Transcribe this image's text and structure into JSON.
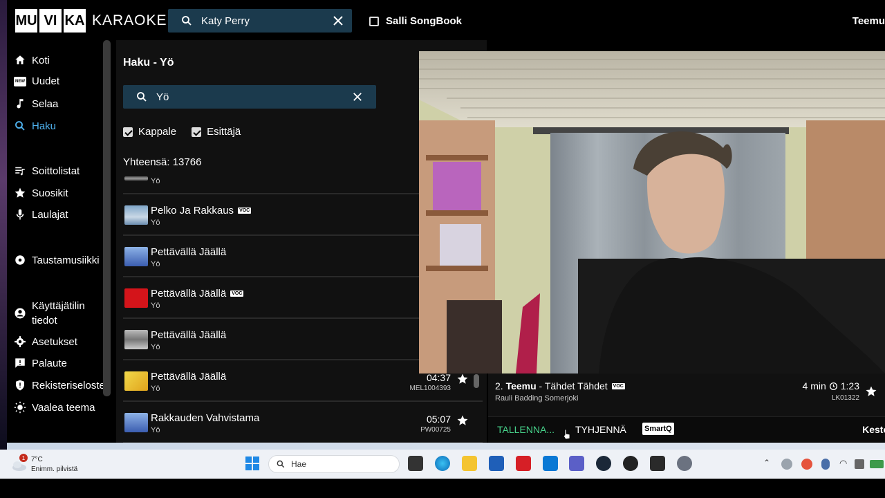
{
  "header": {
    "logo_letters": [
      "MU",
      "VI",
      "KA"
    ],
    "logo_word": "KARAOKE",
    "search_value": "Katy Perry",
    "songbook_label": "Salli SongBook",
    "user_label": "Teemu"
  },
  "sidebar": {
    "items": [
      {
        "label": "Koti"
      },
      {
        "label": "Uudet",
        "badge": "NEW"
      },
      {
        "label": "Selaa"
      },
      {
        "label": "Haku"
      },
      {
        "label": "Soittolistat"
      },
      {
        "label": "Suosikit"
      },
      {
        "label": "Laulajat"
      },
      {
        "label": "Taustamusiikki"
      },
      {
        "label": "Käyttäjätilin tiedot"
      },
      {
        "label": "Asetukset"
      },
      {
        "label": "Palaute"
      },
      {
        "label": "Rekisteriseloste"
      },
      {
        "label": "Vaalea teema"
      }
    ]
  },
  "search_panel": {
    "title": "Haku - Yö",
    "query": "Yö",
    "filter_song": "Kappale",
    "filter_artist": "Esittäjä",
    "total": "Yhteensä: 13766",
    "voc_label": "VOC",
    "results": [
      {
        "title": "",
        "artist": "Yö"
      },
      {
        "title": "Pelko Ja Rakkaus",
        "artist": "Yö",
        "voc": true
      },
      {
        "title": "Pettävällä Jäällä",
        "artist": "Yö"
      },
      {
        "title": "Pettävällä Jäällä",
        "artist": "Yö",
        "voc": true
      },
      {
        "title": "Pettävällä Jäällä",
        "artist": "Yö"
      },
      {
        "title": "Pettävällä Jäällä",
        "artist": "Yö",
        "duration": "04:37",
        "code": "MEL1004393"
      },
      {
        "title": "Rakkauden Vahvistama",
        "artist": "Yö",
        "duration": "05:07",
        "code": "PW00725"
      }
    ]
  },
  "queue": {
    "number": "2.",
    "singer": "Teemu",
    "song": " - Tähdet Tähdet",
    "artist": "Rauli Badding Somerjoki",
    "time_left": "4 min",
    "duration": "1:23",
    "code": "LK01322",
    "save_label": "TALLENNA...",
    "clear_label": "TYHJENNÄ",
    "smartq_label": "SmartQ",
    "duration_label": "Kesto"
  },
  "taskbar": {
    "temperature": "7°C",
    "weather": "Enimm. pilvistä",
    "notification_count": "1",
    "search_placeholder": "Hae"
  },
  "colors": {
    "accent_blue": "#4fb3f0",
    "search_bg": "#1b3a4d",
    "save_green": "#46d18a"
  }
}
